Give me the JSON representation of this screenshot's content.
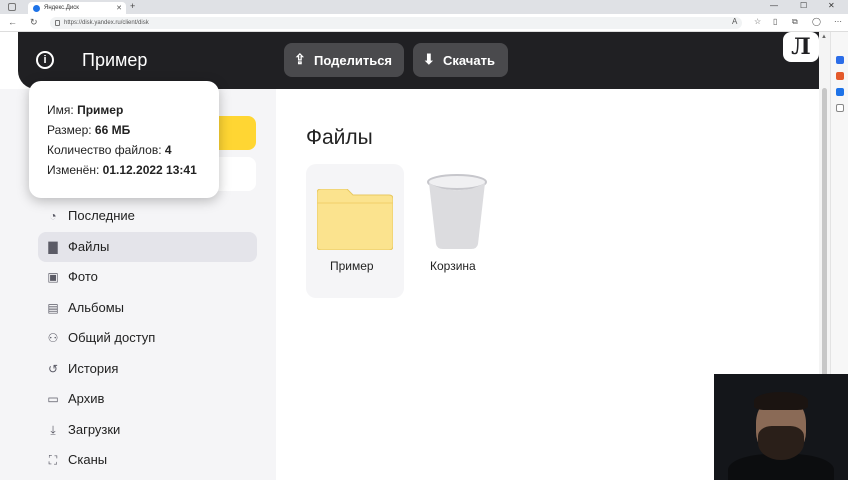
{
  "browser": {
    "tab_title": "Яндекс.Диск",
    "tab_close": "✕",
    "new_tab": "+",
    "url": "https://disk.yandex.ru/client/disk",
    "window_controls": [
      "—",
      "☐",
      "✕"
    ]
  },
  "header": {
    "title": "Пример",
    "share_label": "Поделиться",
    "download_label": "Скачать",
    "logo": "Л"
  },
  "tooltip": {
    "name_label": "Имя:",
    "name_value": "Пример",
    "size_label": "Размер:",
    "size_value": "66 МБ",
    "count_label": "Количество файлов:",
    "count_value": "4",
    "modified_label": "Изменён:",
    "modified_value": "01.12.2022 13:41"
  },
  "sidebar": {
    "items": [
      {
        "label": "Последние",
        "icon": "clock-icon"
      },
      {
        "label": "Файлы",
        "icon": "file-icon"
      },
      {
        "label": "Фото",
        "icon": "photo-icon"
      },
      {
        "label": "Альбомы",
        "icon": "albums-icon"
      },
      {
        "label": "Общий доступ",
        "icon": "users-icon"
      },
      {
        "label": "История",
        "icon": "history-icon"
      },
      {
        "label": "Архив",
        "icon": "archive-icon"
      },
      {
        "label": "Загрузки",
        "icon": "download-icon"
      },
      {
        "label": "Сканы",
        "icon": "scan-icon"
      }
    ]
  },
  "main": {
    "title": "Файлы",
    "items": [
      {
        "label": "Пример",
        "icon": "folder-icon"
      },
      {
        "label": "Корзина",
        "icon": "trash-icon"
      }
    ]
  },
  "colors": {
    "header_bg": "#202023",
    "accent_yellow": "#ffd633",
    "folder": "#fbe38e"
  }
}
